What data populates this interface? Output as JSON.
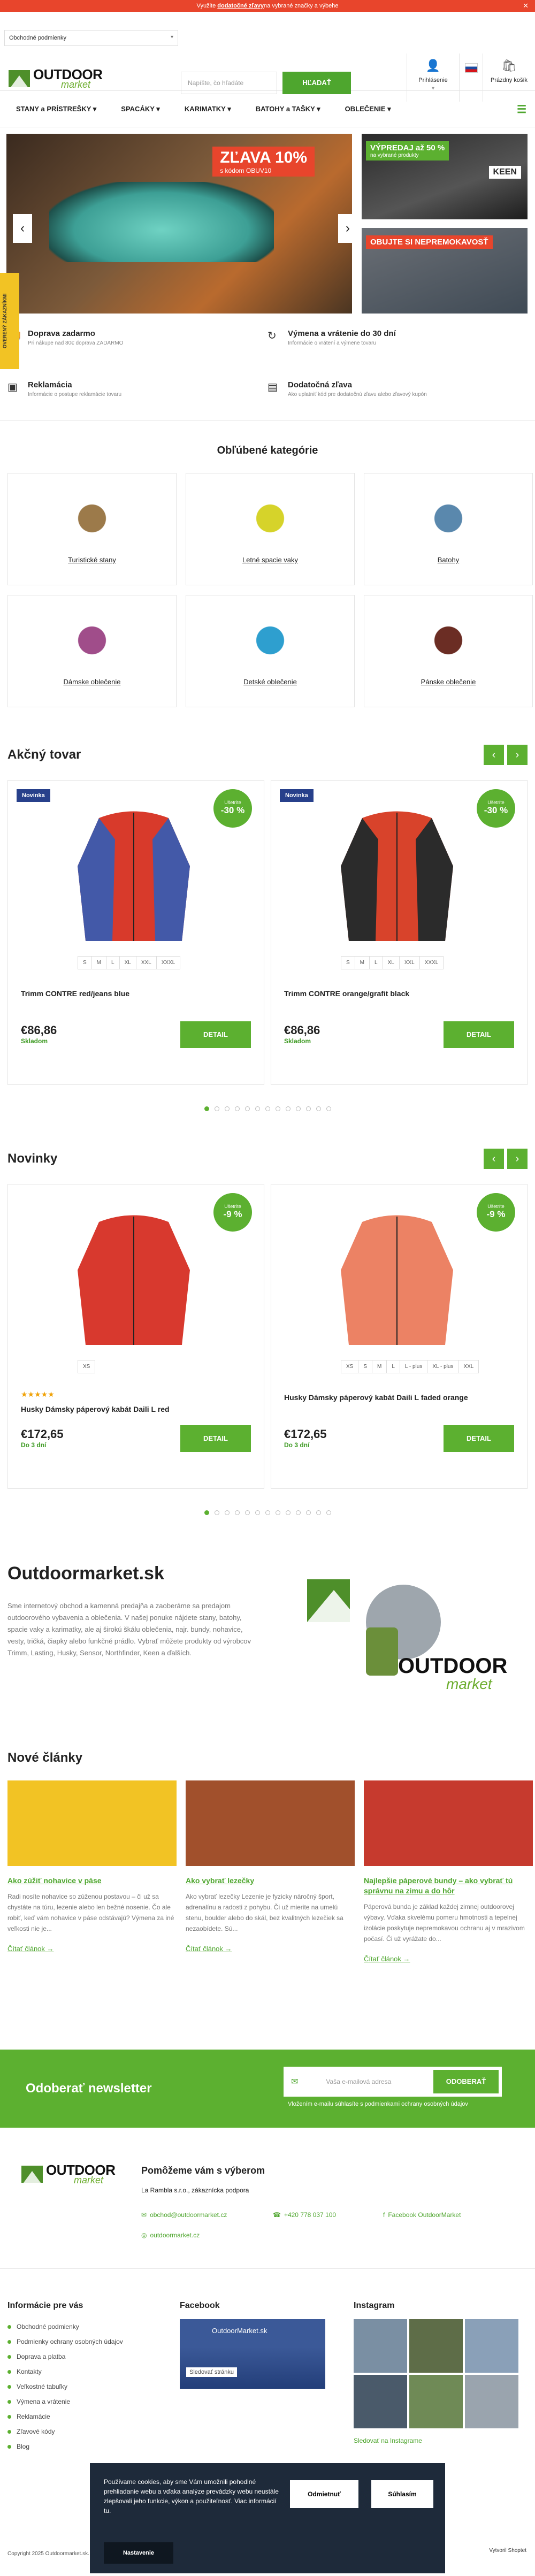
{
  "topbar": {
    "pre": "Využite ",
    "link": "dodatočné zľavy",
    "post": " na vybrané značky a výbehe"
  },
  "header": {
    "conditions_select": "Obchodné podmienky",
    "logo_main": "OUTDOOR",
    "logo_sub": "market",
    "search_placeholder": "Napíšte, čo hľadáte",
    "search_button": "HĽADAŤ",
    "login_label": "Prihlásenie",
    "cart_label": "Prázdny košík"
  },
  "nav": [
    "STANY a PRÍSTREŠKY",
    "SPACÁKY",
    "KARIMATKY",
    "BATOHY a TAŠKY",
    "OBLEČENIE"
  ],
  "hero": {
    "main_promo": "ZĽAVA 10%",
    "main_promo_sub": "s kódom OBUV10",
    "side_tab": "OVERENÝ ZÁKAZNÍKMI",
    "banner2_badge": "VÝPREDAJ až 50 %",
    "banner2_sub": "na vybrané produkty",
    "banner2_brand": "KEEN",
    "banner3_badge": "OBUJTE SI NEPREMOKAVOSŤ"
  },
  "usp": [
    {
      "title": "Doprava zadarmo",
      "desc": "Pri nákupe nad 80€ doprava ZADARMO",
      "icon": "truck-icon"
    },
    {
      "title": "Výmena a vrátenie do 30 dní",
      "desc": "Informácie o vrátení a výmene tovaru",
      "icon": "return-icon"
    },
    {
      "title": "Reklamácia",
      "desc": "Informácie o postupe reklamácie tovaru",
      "icon": "box-icon"
    },
    {
      "title": "Dodatočná zľava",
      "desc": "Ako uplatniť kód pre dodatočnú zľavu alebo zľavový kupón",
      "icon": "discount-card-icon"
    }
  ],
  "categories": {
    "title": "Obľúbené kategórie",
    "items": [
      {
        "label": "Turistické stany",
        "color": "#9c7a4a"
      },
      {
        "label": "Letné spacie vaky",
        "color": "#d6d32a"
      },
      {
        "label": "Batohy",
        "color": "#5a88ad"
      },
      {
        "label": "Dámske oblečenie",
        "color": "#a04d8a"
      },
      {
        "label": "Detské oblečenie",
        "color": "#2e9fcf"
      },
      {
        "label": "Pánske oblečenie",
        "color": "#6b2d24"
      }
    ]
  },
  "action": {
    "title": "Akčný tovar",
    "products": [
      {
        "badge": "Novinka",
        "disc_label": "Ušetríte",
        "disc": "-30 %",
        "sizes": [
          "S",
          "M",
          "L",
          "XL",
          "XXL",
          "XXXL"
        ],
        "name": "Trimm CONTRE red/jeans blue",
        "price": "€86,86",
        "stock": "Skladom",
        "button": "DETAIL",
        "c1": "#d83a2b",
        "c2": "#4359a8"
      },
      {
        "badge": "Novinka",
        "disc_label": "Ušetríte",
        "disc": "-30 %",
        "sizes": [
          "S",
          "M",
          "L",
          "XL",
          "XXL",
          "XXXL"
        ],
        "name": "Trimm CONTRE orange/grafit black",
        "price": "€86,86",
        "stock": "Skladom",
        "button": "DETAIL",
        "c1": "#d8432b",
        "c2": "#2b2b2b"
      }
    ]
  },
  "novinky": {
    "title": "Novinky",
    "products": [
      {
        "disc_label": "Ušetríte",
        "disc": "-9 %",
        "sizes": [
          "XS"
        ],
        "name": "Husky Dámsky páperový kabát Daili L red",
        "price": "€172,65",
        "stock": "Do 3 dní",
        "button": "DETAIL",
        "stars": "★★★★★",
        "c1": "#d8392e"
      },
      {
        "disc_label": "Ušetríte",
        "disc": "-9 %",
        "sizes": [
          "XS",
          "S",
          "M",
          "L",
          "L - plus",
          "XL - plus",
          "XXL"
        ],
        "name": "Husky Dámsky páperový kabát Daili L faded orange",
        "price": "€172,65",
        "stock": "Do 3 dní",
        "button": "DETAIL",
        "stars": "",
        "c1": "#ec8264"
      }
    ]
  },
  "about": {
    "title": "Outdoormarket.sk",
    "text": "Sme internetový obchod a kamenná predajňa a zaoberáme sa predajom outdoorového vybavenia a oblečenia. V našej ponuke nájdete stany, batohy, spacie vaky a karimatky, ale aj širokú škálu oblečenia, najr. bundy, nohavice, vesty, tričká, čiapky alebo funkčné prádlo. Vybrať môžete produkty od výrobcov Trimm, Lasting, Husky, Sensor, Northfinder, Keen a ďalších."
  },
  "articles": {
    "title": "Nové články",
    "items": [
      {
        "title": "Ako zúžiť nohavice v páse",
        "text": "Radi nosíte nohavice so zúženou postavou – či už sa chystáte na túru, lezenie alebo len bežné nosenie. Čo ale robiť, keď vám nohavice v páse odstávajú? Výmena za iné veľkosti nie je...",
        "more": "Čítať článok →",
        "color": "#f2c324"
      },
      {
        "title": "Ako vybrať lezečky",
        "text": "Ako vybrať lezečky Lezenie je fyzicky náročný šport, adrenalínu a radosti z pohybu. Či už mierite na umelú stenu, boulder alebo do skál, bez kvalitných lezečiek sa nezaobídete. Sú...",
        "more": "Čítať článok →",
        "color": "#a1502c"
      },
      {
        "title": "Najlepšie páperové bundy – ako vybrať tú správnu na zimu a do hôr",
        "text": "Páperová bunda je základ každej zimnej outdoorovej výbavy. Vďaka skvelému pomeru hmotnosti a tepelnej izolácie poskytuje nepremokavou ochranu aj v mrazivom počasí. Či už vyrážate do...",
        "more": "Čítať článok →",
        "color": "#c63a2e"
      }
    ]
  },
  "newsletter": {
    "title": "Odoberať newsletter",
    "placeholder": "Vaša e-mailová adresa",
    "button": "ODOBERAŤ",
    "note": "Vložením e-mailu súhlasíte s podmienkami ochrany osobných údajov"
  },
  "contact": {
    "title": "Pomôžeme vám s výberom",
    "company": "La Rambla s.r.o., zákaznícka podpora",
    "email1": "obchod@outdoormarket.cz",
    "phone": "+420 778 037 100",
    "facebook": "Facebook OutdoorMarket",
    "email2": "outdoormarket.cz"
  },
  "footer": {
    "info_title": "Informácie pre vás",
    "info_links": [
      "Obchodné podmienky",
      "Podmienky ochrany osobných údajov",
      "Doprava a platba",
      "Kontakty",
      "Veľkostné tabuľky",
      "Výmena a vrátenie",
      "Reklamácie",
      "Zľavové kódy",
      "Blog"
    ],
    "fb_title": "Facebook",
    "fb_page": "OutdoorMarket.sk",
    "fb_like": "Sledovať stránku",
    "insta_title": "Instagram",
    "insta_link": "Sledovať na Instagrame",
    "copyright": "Copyright 2025 Outdoormarket.sk. Všetky práva vyhradené.",
    "made": "Vytvoril Shoptet"
  },
  "cookie": {
    "text": "Používame cookies, aby sme Vám umožnili pohodlné prehliadanie webu a vďaka analýze prevádzky webu neustále zlepšovali jeho funkcie, výkon a použiteľnosť. Viac informácií tu.",
    "decline": "Odmietnuť",
    "accept": "Súhlasím",
    "settings": "Nastavenie"
  }
}
